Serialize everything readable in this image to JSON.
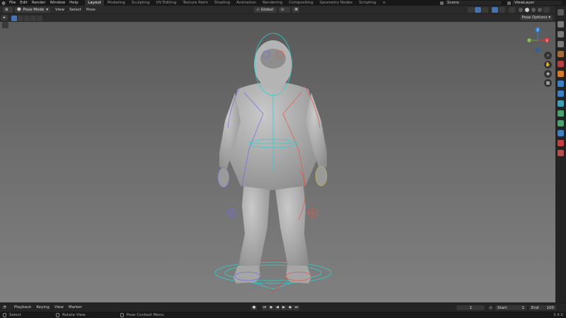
{
  "app": {
    "logo_icon": "blender-logo-icon",
    "menu": [
      "File",
      "Edit",
      "Render",
      "Window",
      "Help"
    ],
    "workspace_tabs": [
      "Layout",
      "Modeling",
      "Sculpting",
      "UV Editing",
      "Texture Paint",
      "Shading",
      "Animation",
      "Rendering",
      "Compositing",
      "Geometry Nodes",
      "Scripting",
      "+"
    ],
    "active_tab": "Layout",
    "scene": "Scene",
    "view_layer": "ViewLayer"
  },
  "viewport_header": {
    "mode": "Pose Mode",
    "menus": [
      "View",
      "Select",
      "Pose"
    ],
    "orientation": "Global"
  },
  "tool_header": {
    "pose_options": "Pose Options"
  },
  "gizmo": {
    "x_label": "X",
    "y_label": "Y",
    "z_label": "Z",
    "colors": {
      "x": "#e0383b",
      "y": "#6fa83a",
      "z": "#2f7fd6"
    }
  },
  "timeline": {
    "menus": [
      "Playback",
      "Keying",
      "View",
      "Marker"
    ],
    "current_frame": "1",
    "start_label": "Start",
    "start": "1",
    "end_label": "End",
    "end": "100"
  },
  "status": {
    "items": [
      "Select",
      "Rotate View",
      "Pose Context Menu"
    ],
    "version": "3.4.0"
  },
  "colors": {
    "accent": "#4772b3",
    "rig_left": "#6f6fe0",
    "rig_right": "#e05a4a",
    "rig_center": "#2fd0d0"
  }
}
